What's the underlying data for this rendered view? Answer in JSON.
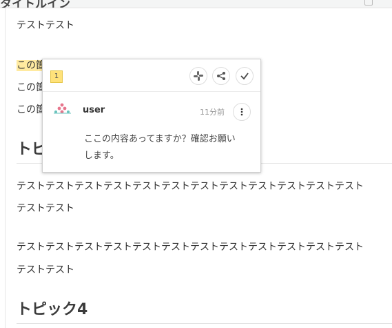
{
  "header": {
    "title": "タイトルイン"
  },
  "doc": {
    "line1": "テストテスト",
    "highlight_prefix": "この箇",
    "line2_prefix": "この箇",
    "line3_prefix": "この箇",
    "heading_partial": "トピ",
    "para1_line1": "テストテストテストテストテストテストテストテストテストテストテストテスト",
    "para1_line2": "テストテスト",
    "para2_line1": "テストテストテストテストテストテストテストテストテストテストテストテスト",
    "para2_line2": "テストテスト",
    "heading4": "トピック4"
  },
  "comment_popup": {
    "badge": "1",
    "icons": [
      "slack-icon",
      "share-icon",
      "check-icon",
      "more-vertical-icon"
    ],
    "user": "user",
    "time": "11分前",
    "body_line1": "ここの内容あってますか？確認お願い",
    "body_line2": "します。"
  },
  "colors": {
    "highlight": "#ffeaa0",
    "badge": "#ffe27a",
    "avatar_pink": "#e7758c",
    "avatar_teal": "#6ac3bd"
  }
}
